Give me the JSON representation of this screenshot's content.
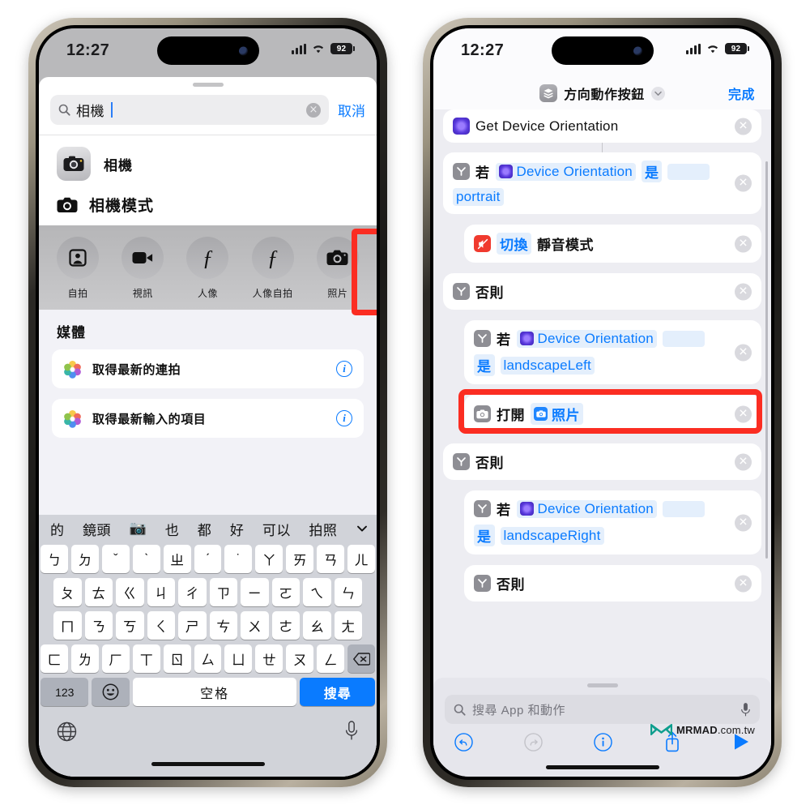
{
  "status_bar": {
    "time": "12:27",
    "battery": "92",
    "signal_icon": "cellular-bars-icon",
    "wifi_icon": "wifi-icon"
  },
  "left_phone": {
    "search": {
      "value": "相機",
      "icon": "search-icon",
      "clear_label": "×",
      "cancel_label": "取消"
    },
    "app_result": {
      "label": "相機",
      "icon": "camera-app-icon"
    },
    "section_header": {
      "label": "相機模式",
      "icon": "camera-icon"
    },
    "camera_modes": [
      {
        "label": "自拍",
        "icon": "portrait-person-icon"
      },
      {
        "label": "視訊",
        "icon": "video-camera-icon"
      },
      {
        "label": "人像",
        "icon": "f-stop-icon"
      },
      {
        "label": "人像自拍",
        "icon": "f-stop-icon"
      },
      {
        "label": "照片",
        "icon": "camera-icon",
        "highlighted": true
      }
    ],
    "media": {
      "title": "媒體",
      "rows": [
        {
          "label": "取得最新的連拍",
          "icon": "photos-app-icon",
          "info": "i"
        },
        {
          "label": "取得最新輸入的項目",
          "icon": "photos-app-icon",
          "info": "i"
        }
      ]
    },
    "keyboard": {
      "suggestions": [
        "的",
        "鏡頭",
        "📷",
        "也",
        "都",
        "好",
        "可以",
        "拍照"
      ],
      "collapse_icon": "chevron-down-icon",
      "row1": [
        "ㄅ",
        "ㄉ",
        "ˇ",
        "ˋ",
        "ㄓ",
        "ˊ",
        "˙",
        "ㄚ",
        "ㄞ",
        "ㄢ",
        "ㄦ"
      ],
      "row2": [
        "ㄆ",
        "ㄊ",
        "ㄍ",
        "ㄐ",
        "ㄔ",
        "ㄗ",
        "ㄧ",
        "ㄛ",
        "ㄟ",
        "ㄣ"
      ],
      "row3": [
        "ㄇ",
        "ㄋ",
        "ㄎ",
        "ㄑ",
        "ㄕ",
        "ㄘ",
        "ㄨ",
        "ㄜ",
        "ㄠ",
        "ㄤ"
      ],
      "row4": [
        "ㄈ",
        "ㄌ",
        "ㄏ",
        "ㄒ",
        "ㄖ",
        "ㄙ",
        "ㄩ",
        "ㄝ",
        "ㄡ",
        "ㄥ"
      ],
      "backspace_icon": "backspace-icon",
      "numbers_key": "123",
      "emoji_key": "emoji-icon",
      "space_key": "空格",
      "search_key": "搜尋",
      "globe_icon": "globe-icon",
      "mic_icon": "microphone-icon"
    }
  },
  "right_phone": {
    "nav": {
      "title": "方向動作按鈕",
      "icon": "shortcuts-icon",
      "chevron": "chevron-down-icon",
      "done_label": "完成"
    },
    "actions": [
      {
        "type": "action",
        "icon": "get-device-orientation-icon",
        "text": "Get Device Orientation",
        "indent": false
      },
      {
        "type": "if",
        "icon": "if-icon",
        "prefix": "若",
        "token_icon": "get-device-orientation-icon",
        "token": "Device Orientation",
        "op": "是",
        "blank": true,
        "value": "portrait",
        "indent": false
      },
      {
        "type": "action",
        "icon": "mute-icon",
        "token": "切換",
        "text": "靜音模式",
        "indent": true
      },
      {
        "type": "otherwise",
        "icon": "if-icon",
        "text": "否則",
        "indent": false
      },
      {
        "type": "if",
        "icon": "if-icon",
        "prefix": "若",
        "token_icon": "get-device-orientation-icon",
        "token": "Device Orientation",
        "op": "是",
        "blank": true,
        "value": "landscapeLeft",
        "indent": true
      },
      {
        "type": "action",
        "icon": "camera-icon",
        "text": "打開",
        "token_icon": "photos-blue-icon",
        "token": "照片",
        "indent": true,
        "highlighted": true
      },
      {
        "type": "otherwise",
        "icon": "if-icon",
        "text": "否則",
        "indent": false
      },
      {
        "type": "if",
        "icon": "if-icon",
        "prefix": "若",
        "token_icon": "get-device-orientation-icon",
        "token": "Device Orientation",
        "op": "是",
        "blank": true,
        "value": "landscapeRight",
        "indent": true
      },
      {
        "type": "otherwise",
        "icon": "if-icon",
        "text": "否則",
        "indent": true
      }
    ],
    "bottom": {
      "search_placeholder": "搜尋 App 和動作",
      "search_icon": "search-icon",
      "mic_icon": "microphone-icon",
      "tools": [
        "undo-icon",
        "redo-icon",
        "info-icon",
        "share-icon",
        "play-icon"
      ]
    },
    "watermark": {
      "brand": "MRMAD",
      "suffix": ".com.tw",
      "icon": "mrmad-logo-icon"
    }
  },
  "colors": {
    "accent_blue": "#0a7bff",
    "highlight_red": "#fb2d22",
    "token_bg": "#e4effc",
    "keyboard_bg": "#d1d3d9",
    "mrmad_teal": "#0f9e8e"
  }
}
